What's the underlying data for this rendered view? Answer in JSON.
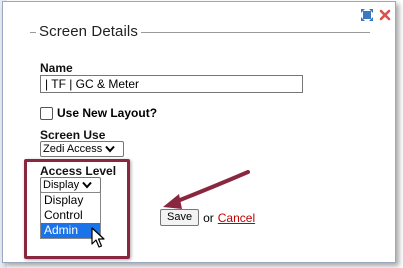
{
  "dialog": {
    "section_title": "Screen Details",
    "name": {
      "label": "Name",
      "value": "| TF | GC & Meter"
    },
    "use_new_layout": {
      "label": "Use New Layout?",
      "checked": false
    },
    "screen_use": {
      "label": "Screen Use",
      "selected": "Zedi Access"
    },
    "access_level": {
      "label": "Access Level",
      "selected": "Display",
      "options": [
        "Display",
        "Control",
        "Admin"
      ],
      "hovered_option": "Admin"
    },
    "save_label": "Save",
    "or_text": "or",
    "cancel_label": "Cancel"
  },
  "colors": {
    "highlight_border": "#8a2740",
    "arrow": "#8a2740",
    "cancel_link": "#c00000",
    "option_hover": "#1a73e8",
    "close_icon": "#d9534f",
    "expand_icon": "#3a78c2"
  },
  "icons": [
    "expand-icon",
    "close-icon",
    "chevron-down-icon",
    "mouse-cursor-icon",
    "annotation-arrow-icon"
  ]
}
